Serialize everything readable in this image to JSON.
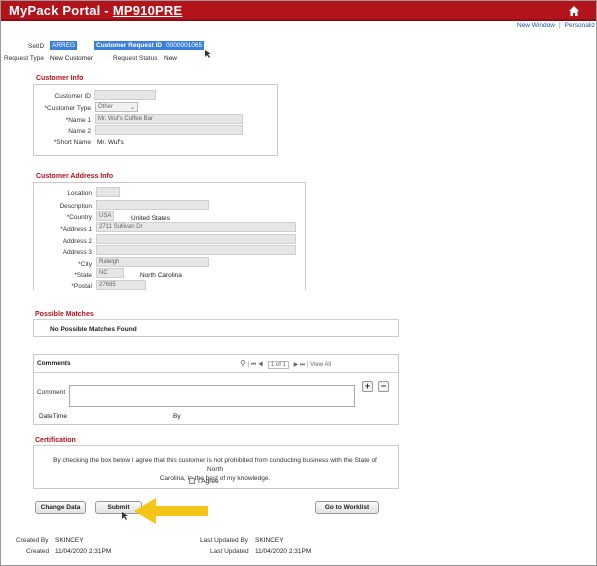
{
  "header": {
    "brand": "MyPack Portal -",
    "page_code": "MP910PRE",
    "links": [
      "New Window",
      "|",
      "Personaliz"
    ]
  },
  "summary": {
    "setid_label": "SetID",
    "setid_value": "ARREG",
    "request_id_label": "Customer Request ID",
    "request_id_value": "0000001065",
    "request_type_label": "Request Type",
    "request_type_value": "New Customer",
    "request_status_label": "Request Status",
    "request_status_value": "New"
  },
  "customer_info": {
    "title": "Customer Info",
    "customer_id_label": "Customer ID",
    "customer_id_value": "",
    "customer_type_label": "*Customer Type",
    "customer_type_value": "Other",
    "name1_label": "*Name 1",
    "name1_value": "Mr. Wuf's Coffee Bar",
    "name2_label": "Name 2",
    "name2_value": "",
    "short_name_label": "*Short Name",
    "short_name_value": "Mr. Wuf's"
  },
  "address_info": {
    "title": "Customer Address Info",
    "location_label": "Location",
    "description_label": "Description",
    "country_label": "*Country",
    "country_code": "USA",
    "country_name": "United States",
    "address1_label": "*Address 1",
    "address1_value": "2711 Sullivan Dr",
    "address2_label": "Address 2",
    "address3_label": "Address 3",
    "city_label": "*City",
    "city_value": "Raleigh",
    "state_label": "*State",
    "state_code": "NC",
    "state_name": "North Carolina",
    "postal_label": "*Postal",
    "postal_value": "27695"
  },
  "possible_matches": {
    "title": "Possible Matches",
    "message": "No Possible Matches Found"
  },
  "comments": {
    "title": "Comments",
    "pager": "1 of 1",
    "view_all": "View All",
    "comment_label": "Comment",
    "datetime_label": "DateTime",
    "by_label": "By"
  },
  "certification": {
    "title": "Certification",
    "text_line1": "By checking the box below I agree that this customer is not prohibited from conducting business with the State of North",
    "text_line2": "Carolina, to the best of my knowledge.",
    "agree_label": "I Agree"
  },
  "buttons": {
    "change_data": "Change Data",
    "submit": "Submit",
    "go_to_worklist": "Go to Worklist"
  },
  "audit": {
    "created_by_label": "Created By",
    "created_by_value": "SKINCEY",
    "created_label": "Created",
    "created_value": "11/04/2020  2:31PM",
    "last_updated_by_label": "Last Updated By",
    "last_updated_by_value": "SKINCEY",
    "last_updated_label": "Last Updated",
    "last_updated_value": "11/04/2020  2:31PM"
  },
  "colors": {
    "brand_red": "#b3141b",
    "highlight_blue": "#3b7fd9",
    "arrow_yellow": "#f5c518"
  }
}
